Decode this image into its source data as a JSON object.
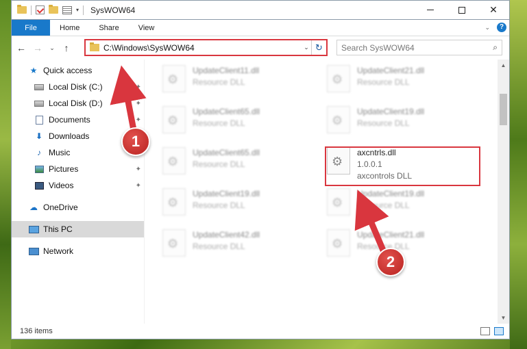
{
  "window": {
    "title": "SysWOW64",
    "controls": {
      "minimize": "—",
      "maximize": "☐",
      "close": "✕"
    }
  },
  "ribbon": {
    "tabs": [
      "File",
      "Home",
      "Share",
      "View"
    ],
    "help": "?",
    "collapse": "⌄"
  },
  "nav": {
    "back": "←",
    "forward": "→",
    "recent": "⌄",
    "up": "↑",
    "address": "C:\\Windows\\SysWOW64",
    "address_dropdown": "⌄",
    "refresh": "↻",
    "search_placeholder": "Search SysWOW64",
    "search_icon": "⌕"
  },
  "sidebar": {
    "items": [
      {
        "label": "Quick access",
        "icon": "star-icon"
      },
      {
        "label": "Local Disk (C:)",
        "icon": "disk-icon",
        "pinned": true
      },
      {
        "label": "Local Disk (D:)",
        "icon": "disk-icon",
        "pinned": true
      },
      {
        "label": "Documents",
        "icon": "document-icon",
        "pinned": true
      },
      {
        "label": "Downloads",
        "icon": "download-icon",
        "pinned": true
      },
      {
        "label": "Music",
        "icon": "music-icon",
        "pinned": true
      },
      {
        "label": "Pictures",
        "icon": "pictures-icon",
        "pinned": true
      },
      {
        "label": "Videos",
        "icon": "videos-icon",
        "pinned": true
      },
      {
        "label": "OneDrive",
        "icon": "cloud-icon"
      },
      {
        "label": "This PC",
        "icon": "computer-icon",
        "selected": true
      },
      {
        "label": "Network",
        "icon": "network-icon"
      }
    ],
    "pin_glyph": "📌"
  },
  "files": [
    {
      "name": "UpdateClient11.dll",
      "type": "Resource DLL"
    },
    {
      "name": "UpdateClient21.dll",
      "type": "Resource DLL"
    },
    {
      "name": "UpdateClient65.dll",
      "type": "Resource DLL"
    },
    {
      "name": "UpdateClient19.dll",
      "type": "Resource DLL"
    },
    {
      "name": "UpdateClient65.dll",
      "type": "Resource DLL"
    },
    {
      "name": "axcntrls.dll",
      "version": "1.0.0.1",
      "type": "axcontrols DLL"
    },
    {
      "name": "UpdateClient19.dll",
      "type": "Resource DLL"
    },
    {
      "name": "UpdateClient19.dll",
      "type": "Resource DLL"
    },
    {
      "name": "UpdateClient42.dll",
      "type": "Resource DLL"
    },
    {
      "name": "UpdateClient21.dll",
      "type": "Resource DLL"
    }
  ],
  "status": {
    "item_count": "136 items"
  },
  "annotations": {
    "step1": "1",
    "step2": "2",
    "color": "#d9363e"
  }
}
